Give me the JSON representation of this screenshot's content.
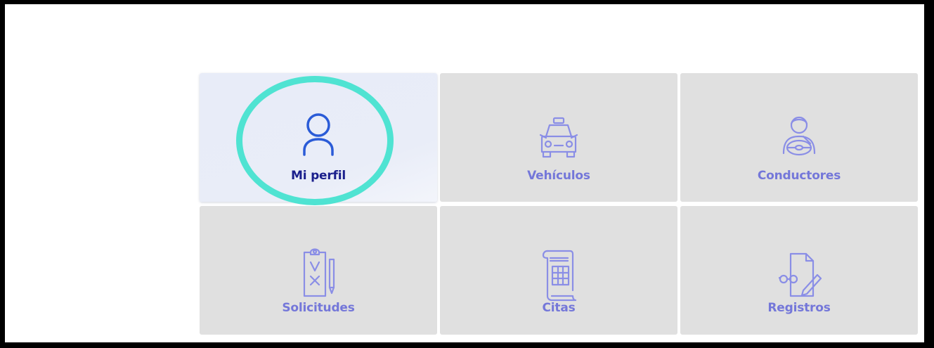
{
  "dashboard": {
    "tiles": [
      {
        "label": "Mi perfil",
        "icon": "user-icon",
        "active": true
      },
      {
        "label": "Vehículos",
        "icon": "taxi-icon",
        "active": false
      },
      {
        "label": "Conductores",
        "icon": "driver-icon",
        "active": false
      },
      {
        "label": "Solicitudes",
        "icon": "clipboard-checklist-icon",
        "active": false
      },
      {
        "label": "Citas",
        "icon": "scroll-calendar-icon",
        "active": false
      },
      {
        "label": "Registros",
        "icon": "document-edit-icon",
        "active": false
      }
    ]
  },
  "colors": {
    "tile_bg": "#e0e0e0",
    "active_tile_bg": "#e9edf8",
    "label": "#7477d9",
    "active_label": "#1a1f8c",
    "icon_light": "#8a8ee6",
    "icon_active": "#2a5bd7",
    "highlight": "#4fe3d2"
  }
}
